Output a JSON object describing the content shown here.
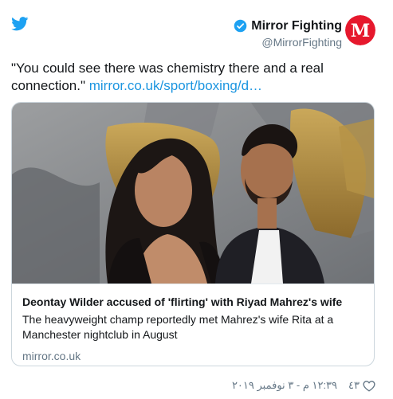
{
  "colors": {
    "accent": "#1b95e0",
    "text": "#14171a",
    "muted": "#657786",
    "border": "#ccd6dd",
    "mirror_red": "#e6182d"
  },
  "icons": {
    "brand": "twitter-bird-icon",
    "verified": "verified-badge-icon",
    "like": "heart-icon"
  },
  "author": {
    "display_name": "Mirror Fighting",
    "handle": "@MirrorFighting",
    "avatar_letter": "M"
  },
  "tweet": {
    "text": "\"You could see there was chemistry there and a real connection.\" ",
    "link": "mirror.co.uk/sport/boxing/d…"
  },
  "card": {
    "title": "Deontay Wilder accused of 'flirting' with Riyad Mahrez's wife",
    "description": "The heavyweight champ reportedly met Mahrez's wife Rita at a Manchester nightclub in August",
    "domain": "mirror.co.uk"
  },
  "footer": {
    "like_count": "٤٣",
    "timestamp": "١٢:٣٩ م - ٣ نوفمبر ٢٠١٩"
  }
}
